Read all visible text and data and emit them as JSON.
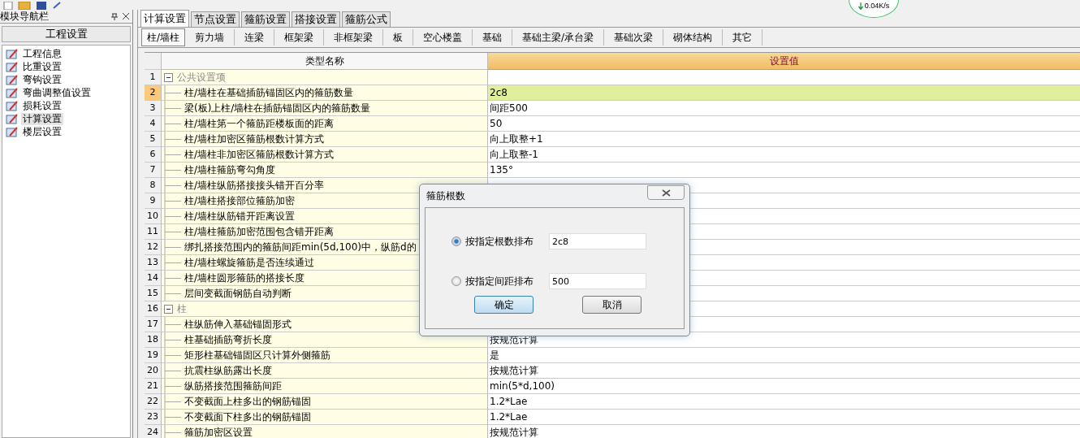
{
  "net_speed": "0.04K/s",
  "nav": {
    "title": "模块导航栏",
    "section": "工程设置",
    "items": [
      {
        "label": "工程信息",
        "selected": false
      },
      {
        "label": "比重设置",
        "selected": false
      },
      {
        "label": "弯钩设置",
        "selected": false
      },
      {
        "label": "弯曲调整值设置",
        "selected": false
      },
      {
        "label": "损耗设置",
        "selected": false
      },
      {
        "label": "计算设置",
        "selected": true
      },
      {
        "label": "楼层设置",
        "selected": false
      }
    ]
  },
  "tabs": [
    {
      "label": "计算设置",
      "selected": true
    },
    {
      "label": "节点设置",
      "selected": false
    },
    {
      "label": "箍筋设置",
      "selected": false
    },
    {
      "label": "搭接设置",
      "selected": false
    },
    {
      "label": "箍筋公式",
      "selected": false
    }
  ],
  "subtabs": [
    {
      "label": "柱/墙柱",
      "selected": true
    },
    {
      "label": "剪力墙",
      "selected": false
    },
    {
      "label": "连梁",
      "selected": false
    },
    {
      "label": "框架梁",
      "selected": false
    },
    {
      "label": "非框架梁",
      "selected": false
    },
    {
      "label": "板",
      "selected": false
    },
    {
      "label": "空心楼盖",
      "selected": false
    },
    {
      "label": "基础",
      "selected": false
    },
    {
      "label": "基础主梁/承台梁",
      "selected": false
    },
    {
      "label": "基础次梁",
      "selected": false
    },
    {
      "label": "砌体结构",
      "selected": false
    },
    {
      "label": "其它",
      "selected": false
    }
  ],
  "table": {
    "columns": [
      "类型名称",
      "设置值"
    ],
    "rows": [
      {
        "num": "1",
        "kind": "group",
        "expanded": true,
        "label": "公共设置项",
        "selected": false
      },
      {
        "num": "2",
        "kind": "item",
        "label": "柱/墙柱在基础插筋锚固区内的箍筋数量",
        "value": "2c8",
        "selected": true
      },
      {
        "num": "3",
        "kind": "item",
        "label": "梁(板)上柱/墙柱在插筋锚固区内的箍筋数量",
        "value": "间距500",
        "selected": false
      },
      {
        "num": "4",
        "kind": "item",
        "label": "柱/墙柱第一个箍筋距楼板面的距离",
        "value": "50",
        "selected": false
      },
      {
        "num": "5",
        "kind": "item",
        "label": "柱/墙柱加密区箍筋根数计算方式",
        "value": "向上取整+1",
        "selected": false
      },
      {
        "num": "6",
        "kind": "item",
        "label": "柱/墙柱非加密区箍筋根数计算方式",
        "value": "向上取整-1",
        "selected": false
      },
      {
        "num": "7",
        "kind": "item",
        "label": "柱/墙柱箍筋弯勾角度",
        "value": "135°",
        "selected": false
      },
      {
        "num": "8",
        "kind": "item",
        "label": "柱/墙柱纵筋搭接接头错开百分率",
        "selected": false
      },
      {
        "num": "9",
        "kind": "item",
        "label": "柱/墙柱搭接部位箍筋加密",
        "selected": false
      },
      {
        "num": "10",
        "kind": "item",
        "label": "柱/墙柱纵筋错开距离设置",
        "selected": false
      },
      {
        "num": "11",
        "kind": "item",
        "label": "柱/墙柱箍筋加密范围包含错开距离",
        "selected": false
      },
      {
        "num": "12",
        "kind": "item",
        "label": "绑扎搭接范围内的箍筋间距min(5d,100)中，纵筋d的",
        "selected": false
      },
      {
        "num": "13",
        "kind": "item",
        "label": "柱/墙柱螺旋箍筋是否连续通过",
        "selected": false
      },
      {
        "num": "14",
        "kind": "item",
        "label": "柱/墙柱圆形箍筋的搭接长度",
        "selected": false
      },
      {
        "num": "15",
        "kind": "item",
        "label": "层间变截面钢筋自动判断",
        "selected": false
      },
      {
        "num": "16",
        "kind": "group",
        "expanded": true,
        "label": "柱",
        "selected": false
      },
      {
        "num": "17",
        "kind": "item",
        "label": "柱纵筋伸入基础锚固形式",
        "selected": false
      },
      {
        "num": "18",
        "kind": "item",
        "label": "柱基础插筋弯折长度",
        "value": "按规范计算",
        "selected": false
      },
      {
        "num": "19",
        "kind": "item",
        "label": "矩形柱基础锚固区只计算外侧箍筋",
        "value": "是",
        "selected": false
      },
      {
        "num": "20",
        "kind": "item",
        "label": "抗震柱纵筋露出长度",
        "value": "按规范计算",
        "selected": false
      },
      {
        "num": "21",
        "kind": "item",
        "label": "纵筋搭接范围箍筋间距",
        "value": "min(5*d,100)",
        "selected": false
      },
      {
        "num": "22",
        "kind": "item",
        "label": "不变截面上柱多出的钢筋锚固",
        "value": "1.2*Lae",
        "selected": false
      },
      {
        "num": "23",
        "kind": "item",
        "label": "不变截面下柱多出的钢筋锚固",
        "value": "1.2*Lae",
        "selected": false
      },
      {
        "num": "24",
        "kind": "item",
        "label": "箍筋加密区设置",
        "value": "按规范计算",
        "selected": false
      }
    ]
  },
  "dialog": {
    "title": "箍筋根数",
    "options": [
      {
        "label": "按指定根数排布",
        "value": "2c8",
        "selected": true
      },
      {
        "label": "按指定间距排布",
        "value": "500",
        "selected": false
      }
    ],
    "buttons": [
      {
        "label": "确定",
        "focused": true
      },
      {
        "label": "取消",
        "focused": false
      }
    ]
  }
}
